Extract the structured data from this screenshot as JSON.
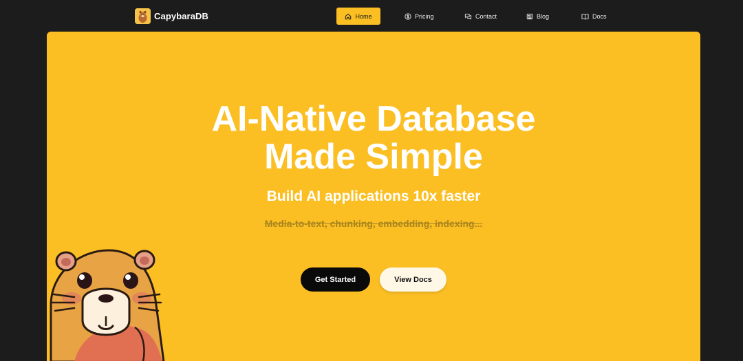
{
  "brand": {
    "name": "CapybaraDB",
    "logo_icon": "capybara-logo-icon"
  },
  "nav": {
    "items": [
      {
        "label": "Home",
        "icon": "home-icon",
        "active": true
      },
      {
        "label": "Pricing",
        "icon": "dollar-circle-icon",
        "active": false
      },
      {
        "label": "Contact",
        "icon": "chat-bubbles-icon",
        "active": false
      },
      {
        "label": "Blog",
        "icon": "newspaper-icon",
        "active": false
      },
      {
        "label": "Docs",
        "icon": "open-book-icon",
        "active": false
      }
    ]
  },
  "hero": {
    "headline_line1": "AI-Native Database",
    "headline_line2": "Made Simple",
    "subheadline": "Build AI applications 10x faster",
    "struck_text": "Media-to-text, chunking, embedding, indexing...",
    "primary_button": "Get Started",
    "secondary_button": "View Docs",
    "mascot": "capybara-mascot"
  },
  "colors": {
    "background": "#1c1c1c",
    "accent": "#fbbf24",
    "primary_button": "#0a0a0a",
    "secondary_button": "#fff8e6"
  }
}
